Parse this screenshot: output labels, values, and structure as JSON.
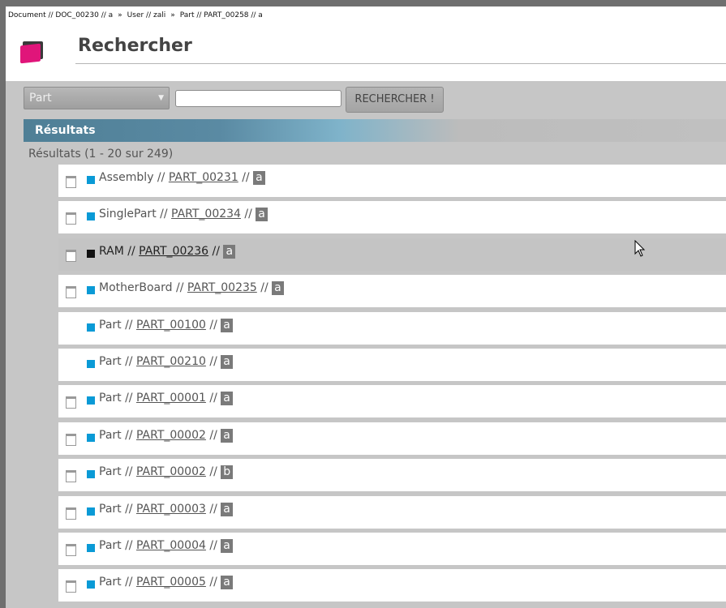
{
  "breadcrumb": {
    "items": [
      "Document // DOC_00230 // a",
      "User // zali",
      "Part // PART_00258 // a"
    ],
    "separator": "»"
  },
  "page": {
    "title": "Rechercher"
  },
  "search": {
    "type_value": "Part",
    "input_value": "",
    "button_label": "RECHERCHER !"
  },
  "results": {
    "header": "Résultats",
    "count_text": "Résultats (1 - 20 sur 249)",
    "rows": [
      {
        "type": "Assembly",
        "id": "PART_00231",
        "version": "a",
        "doc_icon": true,
        "status_color": "#0a9ad6",
        "highlighted": false
      },
      {
        "type": "SinglePart",
        "id": "PART_00234",
        "version": "a",
        "doc_icon": true,
        "status_color": "#0a9ad6",
        "highlighted": false
      },
      {
        "type": "RAM",
        "id": "PART_00236",
        "version": "a",
        "doc_icon": true,
        "status_color": "#111111",
        "highlighted": true
      },
      {
        "type": "MotherBoard",
        "id": "PART_00235",
        "version": "a",
        "doc_icon": true,
        "status_color": "#0a9ad6",
        "highlighted": false
      },
      {
        "type": "Part",
        "id": "PART_00100",
        "version": "a",
        "doc_icon": false,
        "status_color": "#0a9ad6",
        "highlighted": false
      },
      {
        "type": "Part",
        "id": "PART_00210",
        "version": "a",
        "doc_icon": false,
        "status_color": "#0a9ad6",
        "highlighted": false
      },
      {
        "type": "Part",
        "id": "PART_00001",
        "version": "a",
        "doc_icon": true,
        "status_color": "#0a9ad6",
        "highlighted": false
      },
      {
        "type": "Part",
        "id": "PART_00002",
        "version": "a",
        "doc_icon": true,
        "status_color": "#0a9ad6",
        "highlighted": false
      },
      {
        "type": "Part",
        "id": "PART_00002",
        "version": "b",
        "doc_icon": true,
        "status_color": "#0a9ad6",
        "highlighted": false
      },
      {
        "type": "Part",
        "id": "PART_00003",
        "version": "a",
        "doc_icon": true,
        "status_color": "#0a9ad6",
        "highlighted": false
      },
      {
        "type": "Part",
        "id": "PART_00004",
        "version": "a",
        "doc_icon": true,
        "status_color": "#0a9ad6",
        "highlighted": false
      },
      {
        "type": "Part",
        "id": "PART_00005",
        "version": "a",
        "doc_icon": true,
        "status_color": "#0a9ad6",
        "highlighted": false
      }
    ]
  },
  "colors": {
    "accent_pink": "#e0157a",
    "status_blue": "#0a9ad6"
  },
  "icons": {
    "logo": "folder-logo-icon",
    "doc": "document-icon",
    "cursor": "mouse-cursor-icon"
  }
}
